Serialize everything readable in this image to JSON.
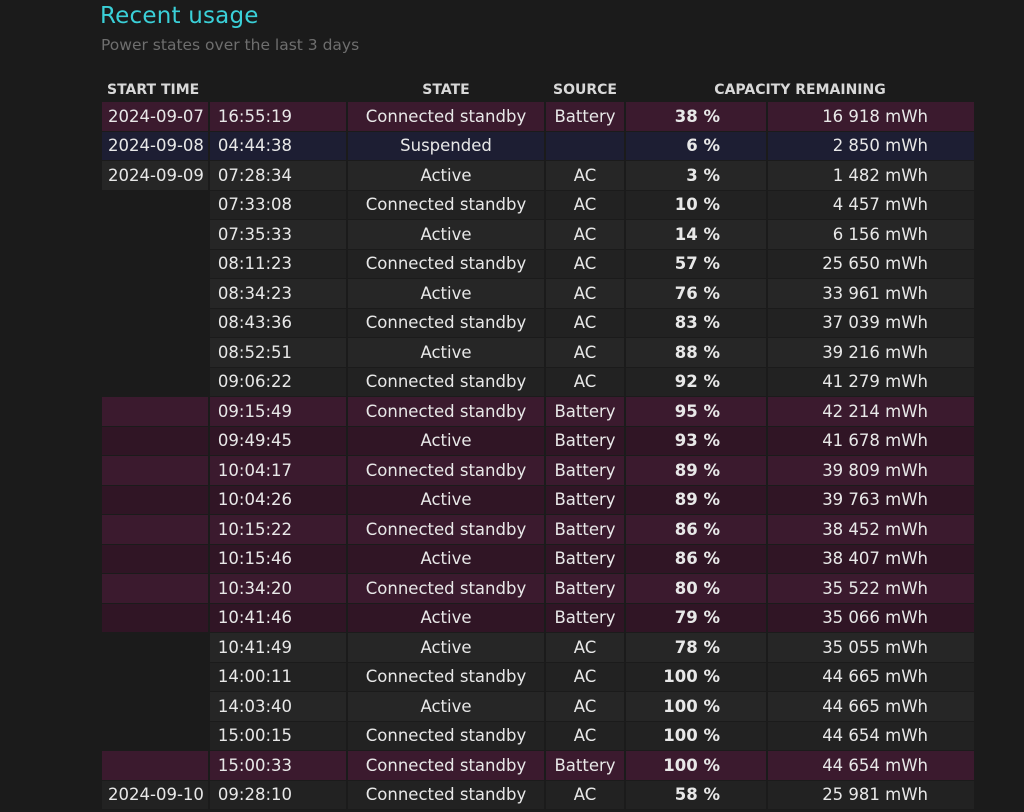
{
  "page": {
    "title": "Recent usage",
    "subtitle": "Power states over the last 3 days"
  },
  "table": {
    "headers": {
      "start_time": "START TIME",
      "state": "STATE",
      "source": "SOURCE",
      "capacity": "CAPACITY REMAINING"
    },
    "rows": [
      {
        "date": "2024-09-07",
        "time": "16:55:19",
        "state": "Connected standby",
        "source": "Battery",
        "percent": "38 %",
        "mwh": "16 918 mWh",
        "kind": "bat-a"
      },
      {
        "date": "2024-09-08",
        "time": "04:44:38",
        "state": "Suspended",
        "source": "",
        "percent": "6 %",
        "mwh": "2 850 mWh",
        "kind": "susp"
      },
      {
        "date": "2024-09-09",
        "time": "07:28:34",
        "state": "Active",
        "source": "AC",
        "percent": "3 %",
        "mwh": "1 482 mWh",
        "kind": "ac-a"
      },
      {
        "date": "",
        "time": "07:33:08",
        "state": "Connected standby",
        "source": "AC",
        "percent": "10 %",
        "mwh": "4 457 mWh",
        "kind": "ac-b"
      },
      {
        "date": "",
        "time": "07:35:33",
        "state": "Active",
        "source": "AC",
        "percent": "14 %",
        "mwh": "6 156 mWh",
        "kind": "ac-a"
      },
      {
        "date": "",
        "time": "08:11:23",
        "state": "Connected standby",
        "source": "AC",
        "percent": "57 %",
        "mwh": "25 650 mWh",
        "kind": "ac-b"
      },
      {
        "date": "",
        "time": "08:34:23",
        "state": "Active",
        "source": "AC",
        "percent": "76 %",
        "mwh": "33 961 mWh",
        "kind": "ac-a"
      },
      {
        "date": "",
        "time": "08:43:36",
        "state": "Connected standby",
        "source": "AC",
        "percent": "83 %",
        "mwh": "37 039 mWh",
        "kind": "ac-b"
      },
      {
        "date": "",
        "time": "08:52:51",
        "state": "Active",
        "source": "AC",
        "percent": "88 %",
        "mwh": "39 216 mWh",
        "kind": "ac-a"
      },
      {
        "date": "",
        "time": "09:06:22",
        "state": "Connected standby",
        "source": "AC",
        "percent": "92 %",
        "mwh": "41 279 mWh",
        "kind": "ac-b"
      },
      {
        "date": "",
        "time": "09:15:49",
        "state": "Connected standby",
        "source": "Battery",
        "percent": "95 %",
        "mwh": "42 214 mWh",
        "kind": "bat-a"
      },
      {
        "date": "",
        "time": "09:49:45",
        "state": "Active",
        "source": "Battery",
        "percent": "93 %",
        "mwh": "41 678 mWh",
        "kind": "bat-b"
      },
      {
        "date": "",
        "time": "10:04:17",
        "state": "Connected standby",
        "source": "Battery",
        "percent": "89 %",
        "mwh": "39 809 mWh",
        "kind": "bat-a"
      },
      {
        "date": "",
        "time": "10:04:26",
        "state": "Active",
        "source": "Battery",
        "percent": "89 %",
        "mwh": "39 763 mWh",
        "kind": "bat-b"
      },
      {
        "date": "",
        "time": "10:15:22",
        "state": "Connected standby",
        "source": "Battery",
        "percent": "86 %",
        "mwh": "38 452 mWh",
        "kind": "bat-a"
      },
      {
        "date": "",
        "time": "10:15:46",
        "state": "Active",
        "source": "Battery",
        "percent": "86 %",
        "mwh": "38 407 mWh",
        "kind": "bat-b"
      },
      {
        "date": "",
        "time": "10:34:20",
        "state": "Connected standby",
        "source": "Battery",
        "percent": "80 %",
        "mwh": "35 522 mWh",
        "kind": "bat-a"
      },
      {
        "date": "",
        "time": "10:41:46",
        "state": "Active",
        "source": "Battery",
        "percent": "79 %",
        "mwh": "35 066 mWh",
        "kind": "bat-b"
      },
      {
        "date": "",
        "time": "10:41:49",
        "state": "Active",
        "source": "AC",
        "percent": "78 %",
        "mwh": "35 055 mWh",
        "kind": "ac-a"
      },
      {
        "date": "",
        "time": "14:00:11",
        "state": "Connected standby",
        "source": "AC",
        "percent": "100 %",
        "mwh": "44 665 mWh",
        "kind": "ac-b"
      },
      {
        "date": "",
        "time": "14:03:40",
        "state": "Active",
        "source": "AC",
        "percent": "100 %",
        "mwh": "44 665 mWh",
        "kind": "ac-a"
      },
      {
        "date": "",
        "time": "15:00:15",
        "state": "Connected standby",
        "source": "AC",
        "percent": "100 %",
        "mwh": "44 654 mWh",
        "kind": "ac-b"
      },
      {
        "date": "",
        "time": "15:00:33",
        "state": "Connected standby",
        "source": "Battery",
        "percent": "100 %",
        "mwh": "44 654 mWh",
        "kind": "bat-a"
      },
      {
        "date": "2024-09-10",
        "time": "09:28:10",
        "state": "Connected standby",
        "source": "AC",
        "percent": "58 %",
        "mwh": "25 981 mWh",
        "kind": "ac-b"
      }
    ]
  },
  "colors": {
    "title": "#3ad0d8",
    "battery_row": "#3b1a2e",
    "battery_row_alt": "#301525",
    "ac_row": "#262626",
    "ac_row_alt": "#222222",
    "suspended_row": "#1d1e33",
    "background": "#1b1b1b"
  }
}
